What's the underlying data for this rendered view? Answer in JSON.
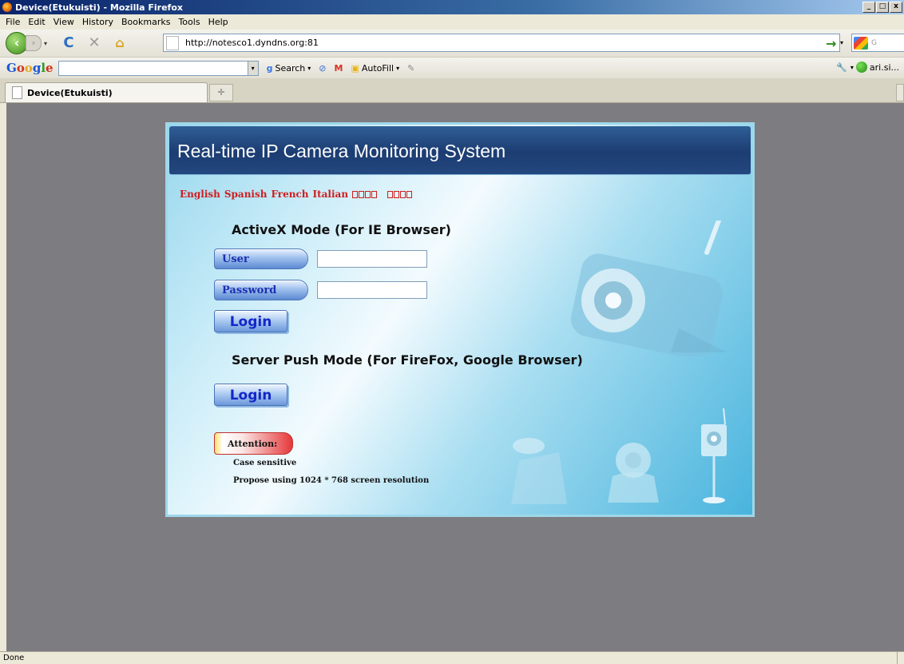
{
  "window": {
    "title": "Device(Etukuisti) - Mozilla Firefox",
    "controls": [
      "_",
      "□",
      "x"
    ]
  },
  "menu": [
    "File",
    "Edit",
    "View",
    "History",
    "Bookmarks",
    "Tools",
    "Help"
  ],
  "nav": {
    "url": "http://notesco1.dyndns.org:81",
    "search_engine_hint": "G"
  },
  "google_toolbar": {
    "logo": "Google",
    "search_label": "Search",
    "autofill_label": "AutoFill",
    "account": "ari.si..."
  },
  "tabs": [
    {
      "label": "Device(Etukuisti)"
    }
  ],
  "page": {
    "banner_title": "Real-time IP Camera Monitoring System",
    "languages": [
      "English",
      "Spanish",
      "French",
      "Italian"
    ],
    "activex_heading": "ActiveX Mode (For IE Browser)",
    "user_label": "User",
    "password_label": "Password",
    "user_value": "",
    "password_value": "",
    "login_label": "Login",
    "push_heading": "Server Push Mode (For FireFox, Google Browser)",
    "attention_label": "Attention:",
    "note_case": "Case sensitive",
    "note_resolution": "Propose using 1024 * 768 screen resolution"
  },
  "status": {
    "text": "Done"
  }
}
